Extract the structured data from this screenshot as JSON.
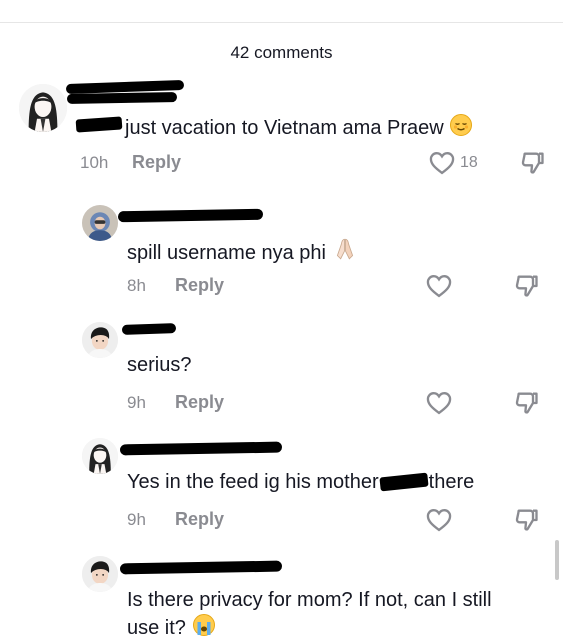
{
  "header": {
    "comment_count": "42 comments"
  },
  "comments": [
    {
      "text": "just vacation to Vietnam ama Praew",
      "emoji": "relieved-face",
      "time": "10h",
      "reply_label": "Reply",
      "likes": "18"
    },
    {
      "text": "spill username nya phi",
      "emoji": "folded-hands",
      "time": "8h",
      "reply_label": "Reply"
    },
    {
      "text": "serius?",
      "time": "9h",
      "reply_label": "Reply"
    },
    {
      "text_before": "Yes in the feed ig his mother",
      "text_after": "there",
      "time": "9h",
      "reply_label": "Reply"
    },
    {
      "text_line1": "Is there privacy for mom? If not, can I still",
      "text_line2": "use it?",
      "emoji": "loudly-crying-face"
    }
  ],
  "icons": {
    "like": "heart-outline-icon",
    "dislike": "thumbs-down-icon"
  },
  "colors": {
    "text": "#161823",
    "muted": "#8a8b91",
    "redaction": "#000000"
  }
}
